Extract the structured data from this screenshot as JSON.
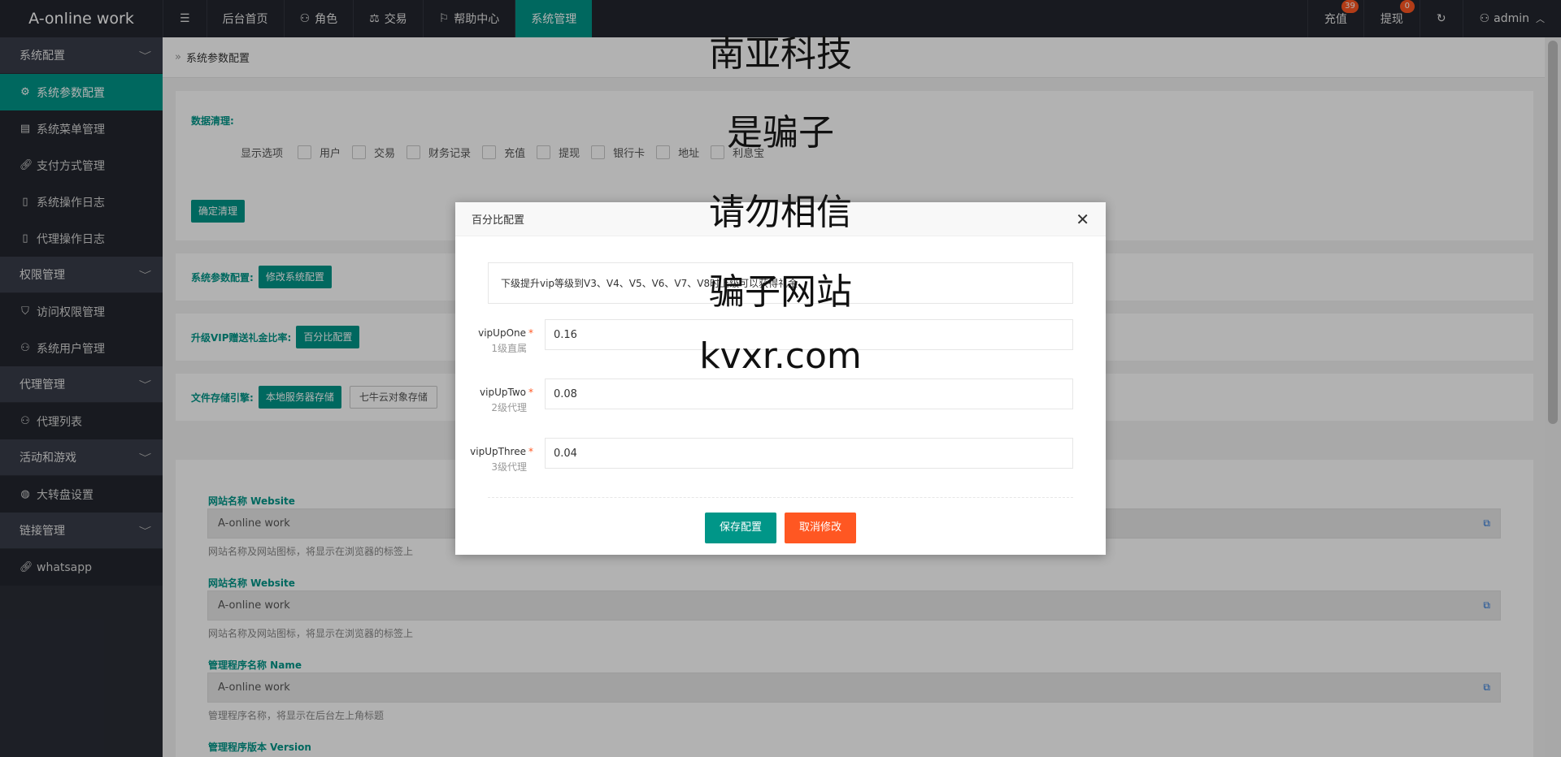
{
  "header": {
    "brand": "A-online work",
    "nav": [
      "后台首页",
      "角色",
      "交易",
      "帮助中心",
      "系统管理"
    ],
    "right": {
      "recharge_label": "充值",
      "recharge_badge": "39",
      "withdraw_label": "提现",
      "withdraw_badge": "0",
      "user": "admin"
    }
  },
  "sidebar": {
    "groups": [
      {
        "label": "系统配置",
        "items": [
          "系统参数配置",
          "系统菜单管理",
          "支付方式管理",
          "系统操作日志",
          "代理操作日志"
        ]
      },
      {
        "label": "权限管理",
        "items": [
          "访问权限管理",
          "系统用户管理"
        ]
      },
      {
        "label": "代理管理",
        "items": [
          "代理列表"
        ]
      },
      {
        "label": "活动和游戏",
        "items": [
          "大转盘设置"
        ]
      },
      {
        "label": "链接管理",
        "items": [
          "whatsapp"
        ]
      }
    ]
  },
  "breadcrumb": "系统参数配置",
  "data_clean": {
    "label": "数据清理:",
    "options_label": "显示选项",
    "options": [
      "用户",
      "交易",
      "财务记录",
      "充值",
      "提现",
      "银行卡",
      "地址",
      "利息宝"
    ],
    "confirm_button": "确定清理"
  },
  "sys_params": {
    "label": "系统参数配置:",
    "button": "修改系统配置"
  },
  "vip_rate": {
    "label": "升级VIP赠送礼金比率:",
    "button": "百分比配置"
  },
  "storage": {
    "label": "文件存储引擎:",
    "buttons": [
      "本地服务器存储",
      "七牛云对象存储"
    ]
  },
  "settings": [
    {
      "label": "网站名称 Website",
      "value": "A-online work",
      "help": "网站名称及网站图标，将显示在浏览器的标签上"
    },
    {
      "label": "网站名称 Website",
      "value": "A-online work",
      "help": "网站名称及网站图标，将显示在浏览器的标签上"
    },
    {
      "label": "管理程序名称 Name",
      "value": "A-online work",
      "help": "管理程序名称，将显示在后台左上角标题"
    },
    {
      "label": "管理程序版本 Version",
      "value": "",
      "help": ""
    }
  ],
  "modal": {
    "title": "百分比配置",
    "notice": "下级提升vip等级到V3、V4、V5、V6、V7、V8时上级可以获得礼金",
    "fields": [
      {
        "name": "vipUpOne",
        "sub": "1级直属",
        "value": "0.16"
      },
      {
        "name": "vipUpTwo",
        "sub": "2级代理",
        "value": "0.08"
      },
      {
        "name": "vipUpThree",
        "sub": "3级代理",
        "value": "0.04"
      }
    ],
    "save_button": "保存配置",
    "cancel_button": "取消修改"
  },
  "watermark": [
    "南亚科技",
    "是骗子",
    "请勿相信",
    "骗子网站",
    "kvxr.com"
  ],
  "colors": {
    "accent": "#009688",
    "danger": "#ff5722",
    "header_bg": "#23262e",
    "sidebar_bg": "#2a2d36"
  }
}
